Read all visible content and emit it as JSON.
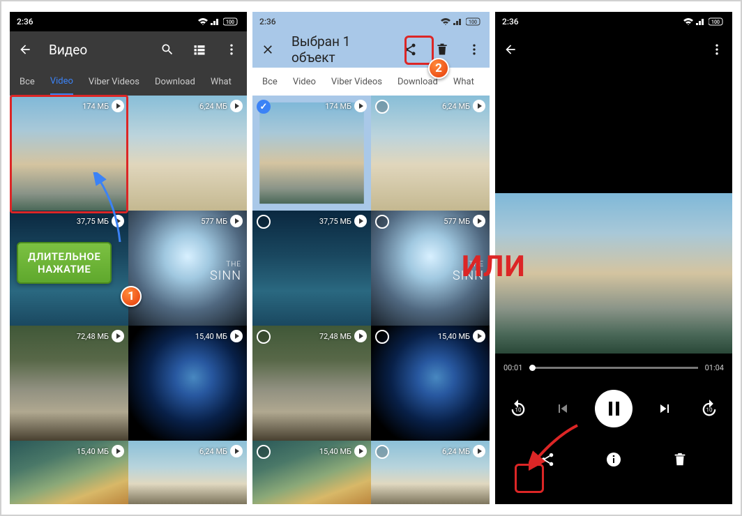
{
  "status": {
    "time": "2:36",
    "battery": "100"
  },
  "screen1": {
    "title": "Видео",
    "tabs": [
      "Все",
      "Video",
      "Viber Videos",
      "Download",
      "What"
    ],
    "active_tab": 1,
    "tiles": [
      {
        "size": "174 МБ"
      },
      {
        "size": "6,24 МБ"
      },
      {
        "size": "37,75 МБ"
      },
      {
        "size": "577 МБ"
      },
      {
        "size": "72,48 МБ"
      },
      {
        "size": "15,40 МБ"
      },
      {
        "size": "15,40 МБ"
      },
      {
        "size": "6,24 МБ"
      }
    ]
  },
  "screen2": {
    "title": "Выбран 1 объект",
    "tabs": [
      "Все",
      "Video",
      "Viber Videos",
      "Download",
      "What"
    ],
    "tiles": [
      {
        "size": "174 МБ"
      },
      {
        "size": "6,24 МБ"
      },
      {
        "size": "37,75 МБ"
      },
      {
        "size": "577 МБ"
      },
      {
        "size": "72,48 МБ"
      },
      {
        "size": "15,40 МБ"
      },
      {
        "size": "15,40 МБ"
      },
      {
        "size": "6,24 МБ"
      }
    ]
  },
  "screen3": {
    "player": {
      "current": "00:01",
      "total": "01:04"
    }
  },
  "sinner": {
    "the": "THE",
    "title": "SINN"
  },
  "annot": {
    "callout_line1": "ДЛИТЕЛЬНОЕ",
    "callout_line2": "НАЖАТИЕ",
    "or": "ИЛИ",
    "badge1": "1",
    "badge2": "2"
  }
}
